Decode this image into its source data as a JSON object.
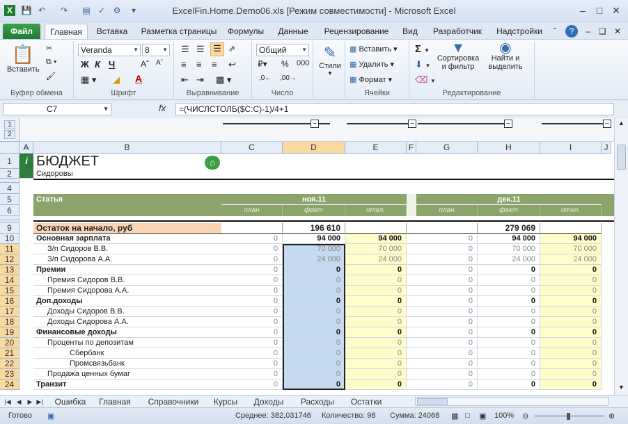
{
  "window": {
    "title": "ExcelFin.Home.Demo06.xls  [Режим совместимости]  -  Microsoft Excel"
  },
  "tabs": [
    "Файл",
    "Главная",
    "Вставка",
    "Разметка страницы",
    "Формулы",
    "Данные",
    "Рецензирование",
    "Вид",
    "Разработчик",
    "Надстройки"
  ],
  "ribbon": {
    "clipboard": {
      "paste": "Вставить",
      "label": "Буфер обмена"
    },
    "font": {
      "name": "Veranda",
      "size": "8",
      "label": "Шрифт"
    },
    "alignment": {
      "label": "Выравнивание"
    },
    "number": {
      "format": "Общий",
      "label": "Число"
    },
    "styles": {
      "label": "Стили"
    },
    "cells": {
      "insert": "Вставить",
      "delete": "Удалить",
      "format": "Формат",
      "label": "Ячейки"
    },
    "editing": {
      "sort": "Сортировка и фильтр",
      "find": "Найти и выделить",
      "label": "Редактирование"
    }
  },
  "formula_bar": {
    "cell": "C7",
    "fx": "fx",
    "formula": "=(ЧИСЛСТОЛБ($C:C)-1)/4+1"
  },
  "sheet": {
    "columns": [
      "A",
      "B",
      "C",
      "D",
      "E",
      "F",
      "G",
      "H",
      "I",
      "J"
    ],
    "outline_levels": [
      "1",
      "2"
    ],
    "title": "БЮДЖЕТ",
    "subtitle": "Сидоровы",
    "header_label": "Статья",
    "months": [
      "ноя.11",
      "дек.11"
    ],
    "subheads": [
      "план",
      "факт",
      "откл."
    ],
    "rows": [
      {
        "n": "9",
        "label": "Остаток на начало, руб",
        "bold": true,
        "fact1": "196 610",
        "fact2": "279 069",
        "style": "opening"
      },
      {
        "n": "10",
        "label": "Основная зарплата",
        "bold": true,
        "indent": 0,
        "plan1": "0",
        "fact1": "94 000",
        "dev1": "94 000",
        "plan2": "0",
        "fact2": "94 000",
        "dev2": "94 000"
      },
      {
        "n": "11",
        "label": "З/п Сидоров В.В.",
        "indent": 1,
        "plan1": "0",
        "fact1": "70 000",
        "dev1": "70 000",
        "plan2": "0",
        "fact2": "70 000",
        "dev2": "70 000"
      },
      {
        "n": "12",
        "label": "З/п Сидорова А.А.",
        "indent": 1,
        "plan1": "0",
        "fact1": "24 000",
        "dev1": "24 000",
        "plan2": "0",
        "fact2": "24 000",
        "dev2": "24 000"
      },
      {
        "n": "13",
        "label": "Премии",
        "bold": true,
        "indent": 0,
        "plan1": "0",
        "fact1": "0",
        "dev1": "0",
        "plan2": "0",
        "fact2": "0",
        "dev2": "0"
      },
      {
        "n": "14",
        "label": "Премия Сидоров В.В.",
        "indent": 1,
        "plan1": "0",
        "fact1": "0",
        "dev1": "0",
        "plan2": "0",
        "fact2": "0",
        "dev2": "0"
      },
      {
        "n": "15",
        "label": "Премия Сидорова А.А.",
        "indent": 1,
        "plan1": "0",
        "fact1": "0",
        "dev1": "0",
        "plan2": "0",
        "fact2": "0",
        "dev2": "0"
      },
      {
        "n": "16",
        "label": "Доп.доходы",
        "bold": true,
        "indent": 0,
        "plan1": "0",
        "fact1": "0",
        "dev1": "0",
        "plan2": "0",
        "fact2": "0",
        "dev2": "0"
      },
      {
        "n": "17",
        "label": "Доходы Сидоров В.В.",
        "indent": 1,
        "plan1": "0",
        "fact1": "0",
        "dev1": "0",
        "plan2": "0",
        "fact2": "0",
        "dev2": "0"
      },
      {
        "n": "18",
        "label": "Доходы Сидорова А.А.",
        "indent": 1,
        "plan1": "0",
        "fact1": "0",
        "dev1": "0",
        "plan2": "0",
        "fact2": "0",
        "dev2": "0"
      },
      {
        "n": "19",
        "label": "Финансовые доходы",
        "bold": true,
        "indent": 0,
        "plan1": "0",
        "fact1": "0",
        "dev1": "0",
        "plan2": "0",
        "fact2": "0",
        "dev2": "0"
      },
      {
        "n": "20",
        "label": "Проценты по депозитам",
        "indent": 1,
        "plan1": "0",
        "fact1": "0",
        "dev1": "0",
        "plan2": "0",
        "fact2": "0",
        "dev2": "0"
      },
      {
        "n": "21",
        "label": "Сбербанк",
        "indent": 2,
        "plan1": "0",
        "fact1": "0",
        "dev1": "0",
        "plan2": "0",
        "fact2": "0",
        "dev2": "0"
      },
      {
        "n": "22",
        "label": "Промсвязьбанк",
        "indent": 2,
        "plan1": "0",
        "fact1": "0",
        "dev1": "0",
        "plan2": "0",
        "fact2": "0",
        "dev2": "0"
      },
      {
        "n": "23",
        "label": "Продажа ценных бумаг",
        "indent": 1,
        "plan1": "0",
        "fact1": "0",
        "dev1": "0",
        "plan2": "0",
        "fact2": "0",
        "dev2": "0"
      },
      {
        "n": "24",
        "label": "Транзит",
        "bold": true,
        "indent": 0,
        "plan1": "0",
        "fact1": "0",
        "dev1": "0",
        "plan2": "0",
        "fact2": "0",
        "dev2": "0"
      }
    ]
  },
  "sheet_tabs": [
    "Ошибка",
    "Главная",
    "Справочники",
    "Курсы",
    "Доходы",
    "Расходы",
    "Остатки"
  ],
  "status": {
    "ready": "Готово",
    "average": "Среднее: 382,031746",
    "count": "Количество: 98",
    "sum": "Сумма: 24068",
    "zoom": "100%"
  }
}
